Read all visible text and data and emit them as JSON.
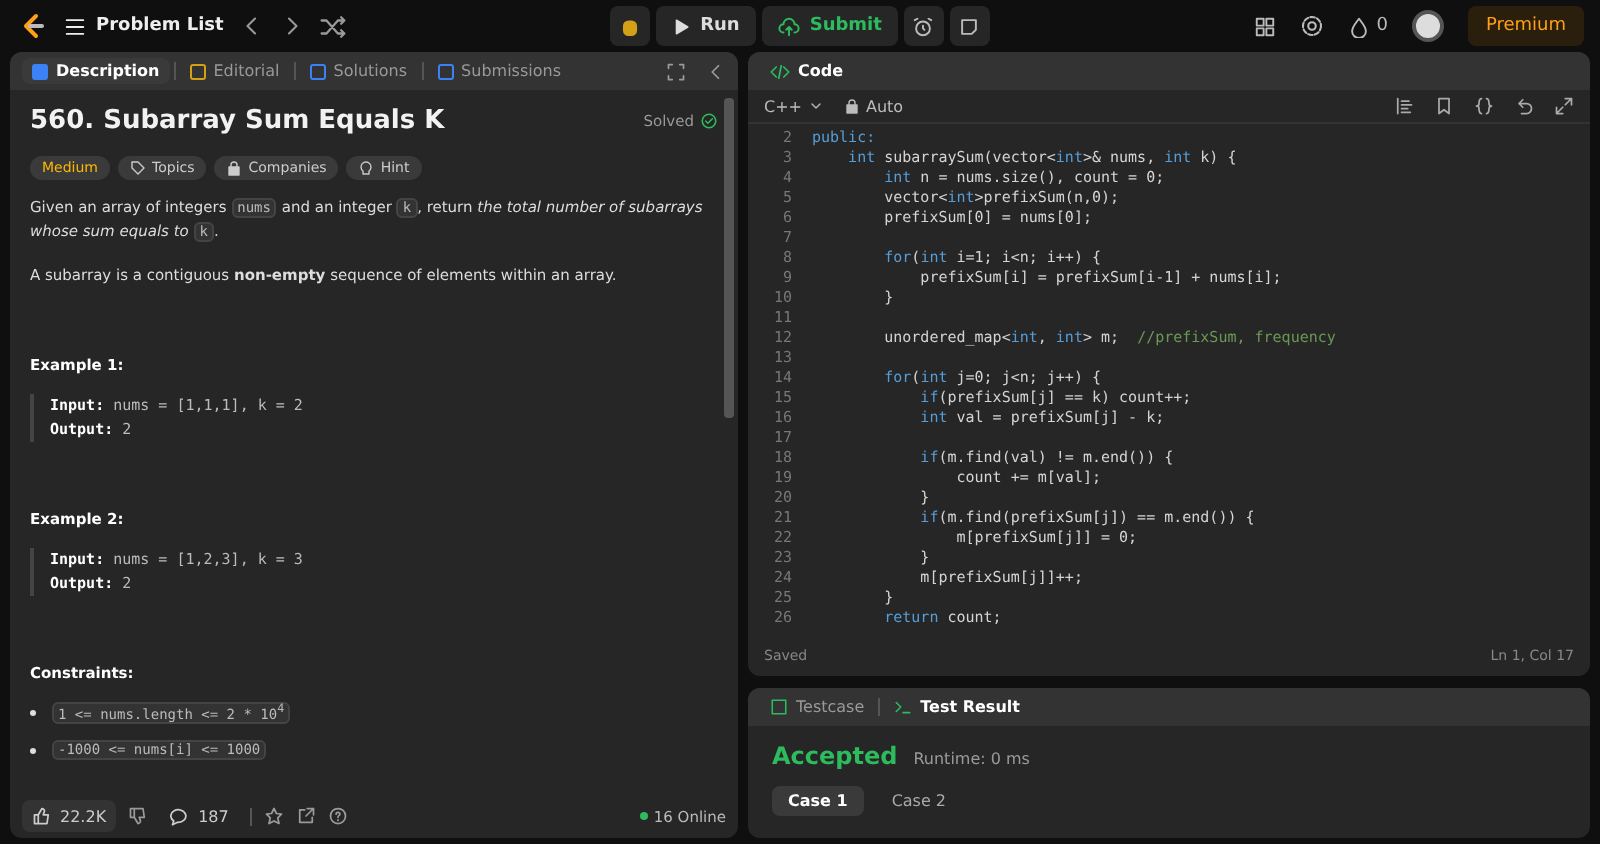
{
  "topbar": {
    "problem_list": "Problem List",
    "run": "Run",
    "submit": "Submit",
    "streak": "0",
    "premium": "Premium"
  },
  "description_tabs": [
    {
      "label": "Description",
      "selected": true,
      "color": "#3b82f6"
    },
    {
      "label": "Editorial",
      "selected": false,
      "color": "#d4a017"
    },
    {
      "label": "Solutions",
      "selected": false,
      "color": "#3b82f6"
    },
    {
      "label": "Submissions",
      "selected": false,
      "color": "#3b82f6"
    }
  ],
  "problem": {
    "title": "560. Subarray Sum Equals K",
    "status": "Solved",
    "difficulty": "Medium",
    "tags": [
      {
        "label": "Topics",
        "kind": "tag"
      },
      {
        "label": "Companies",
        "kind": "lock"
      },
      {
        "label": "Hint",
        "kind": "bulb"
      }
    ],
    "statement": [
      {
        "kind": "text",
        "text": "Given an array of integers "
      },
      {
        "kind": "code",
        "text": "nums"
      },
      {
        "kind": "text",
        "text": " and an integer "
      },
      {
        "kind": "code",
        "text": "k"
      },
      {
        "kind": "text",
        "text": ", return "
      },
      {
        "kind": "italic",
        "text": "the total number of subarrays whose sum equals to "
      },
      {
        "kind": "code",
        "text": "k"
      },
      {
        "kind": "text",
        "text": "."
      }
    ],
    "note": "A subarray is a contiguous **non-empty** sequence of elements within an array.",
    "examples": [
      {
        "heading": "Example 1:",
        "input_label": "Input:",
        "input": "nums = [1,1,1], k = 2",
        "output_label": "Output:",
        "output": "2"
      },
      {
        "heading": "Example 2:",
        "input_label": "Input:",
        "input": "nums = [1,2,3], k = 3",
        "output_label": "Output:",
        "output": "2"
      }
    ],
    "constraints_heading": "Constraints:",
    "constraints": [
      "1 <= nums.length <= 2 * 10$^{4}$",
      "-1000 <= nums[i] <= 1000"
    ]
  },
  "footer": {
    "likes": "22.2K",
    "comments": "187",
    "online": "16 Online"
  },
  "code_panel": {
    "title": "Code",
    "language": "C++",
    "mode": "Auto",
    "status": "Saved",
    "cursor": "Ln 1, Col 17",
    "lines": [
      {
        "number": "2",
        "tokens": [
          {
            "kind": "kw",
            "text": "public:"
          }
        ]
      },
      {
        "number": "3",
        "tokens": [
          {
            "kind": "kw",
            "text": "    int"
          },
          {
            "kind": "plain",
            "text": " subarraySum(vector<"
          },
          {
            "kind": "kw",
            "text": "int"
          },
          {
            "kind": "plain",
            "text": ">& nums, "
          },
          {
            "kind": "kw",
            "text": "int"
          },
          {
            "kind": "plain",
            "text": " k) {"
          }
        ]
      },
      {
        "number": "4",
        "tokens": [
          {
            "kind": "kw",
            "text": "        int"
          },
          {
            "kind": "plain",
            "text": " n = nums.size(), count = 0;"
          }
        ]
      },
      {
        "number": "5",
        "tokens": [
          {
            "kind": "plain",
            "text": "        vector<"
          },
          {
            "kind": "kw",
            "text": "int"
          },
          {
            "kind": "plain",
            "text": ">prefixSum(n,0);"
          }
        ]
      },
      {
        "number": "6",
        "tokens": [
          {
            "kind": "plain",
            "text": "        prefixSum[0] = nums[0];"
          }
        ]
      },
      {
        "number": "7"
      },
      {
        "number": "8",
        "tokens": [
          {
            "kind": "kw",
            "text": "        for"
          },
          {
            "kind": "plain",
            "text": "("
          },
          {
            "kind": "kw",
            "text": "int"
          },
          {
            "kind": "plain",
            "text": " i=1; i<n; i++) {"
          }
        ]
      },
      {
        "number": "9",
        "tokens": [
          {
            "kind": "plain",
            "text": "            prefixSum[i] = prefixSum[i-1] + nums[i];"
          }
        ]
      },
      {
        "number": "10",
        "tokens": [
          {
            "kind": "plain",
            "text": "        }"
          }
        ]
      },
      {
        "number": "11"
      },
      {
        "number": "12",
        "tokens": [
          {
            "kind": "plain",
            "text": "        unordered_map<"
          },
          {
            "kind": "kw",
            "text": "int"
          },
          {
            "kind": "plain",
            "text": ", "
          },
          {
            "kind": "kw",
            "text": "int"
          },
          {
            "kind": "plain",
            "text": "> m;  "
          },
          {
            "kind": "comment",
            "text": "//prefixSum, frequency"
          }
        ]
      },
      {
        "number": "13"
      },
      {
        "number": "14",
        "tokens": [
          {
            "kind": "kw",
            "text": "        for"
          },
          {
            "kind": "plain",
            "text": "("
          },
          {
            "kind": "kw",
            "text": "int"
          },
          {
            "kind": "plain",
            "text": " j=0; j<n; j++) {"
          }
        ]
      },
      {
        "number": "15",
        "tokens": [
          {
            "kind": "kw",
            "text": "            if"
          },
          {
            "kind": "plain",
            "text": "(prefixSum[j] == k) count++;"
          }
        ]
      },
      {
        "number": "16",
        "tokens": [
          {
            "kind": "kw",
            "text": "            int"
          },
          {
            "kind": "plain",
            "text": " val = prefixSum[j] - k;"
          }
        ]
      },
      {
        "number": "17"
      },
      {
        "number": "18",
        "tokens": [
          {
            "kind": "kw",
            "text": "            if"
          },
          {
            "kind": "plain",
            "text": "(m.find(val) != m.end()) {"
          }
        ]
      },
      {
        "number": "19",
        "tokens": [
          {
            "kind": "plain",
            "text": "                count += m[val];"
          }
        ]
      },
      {
        "number": "20",
        "tokens": [
          {
            "kind": "plain",
            "text": "            }"
          }
        ]
      },
      {
        "number": "21",
        "tokens": [
          {
            "kind": "kw",
            "text": "            if"
          },
          {
            "kind": "plain",
            "text": "(m.find(prefixSum[j]) == m.end()) {"
          }
        ]
      },
      {
        "number": "22",
        "tokens": [
          {
            "kind": "plain",
            "text": "                m[prefixSum[j]] = 0;"
          }
        ]
      },
      {
        "number": "23",
        "tokens": [
          {
            "kind": "plain",
            "text": "            }"
          }
        ]
      },
      {
        "number": "24",
        "tokens": [
          {
            "kind": "plain",
            "text": "            m[prefixSum[j]]++;"
          }
        ]
      },
      {
        "number": "25",
        "tokens": [
          {
            "kind": "plain",
            "text": "        }"
          }
        ]
      },
      {
        "number": "26",
        "tokens": [
          {
            "kind": "kw",
            "text": "        return"
          },
          {
            "kind": "plain",
            "text": " count;"
          }
        ]
      }
    ]
  },
  "test_tabs": [
    {
      "label": "Testcase",
      "selected": false
    },
    {
      "label": "Test Result",
      "selected": true
    }
  ],
  "result": {
    "verdict": "Accepted",
    "runtime": "Runtime: 0 ms",
    "cases": [
      {
        "label": "Case 1",
        "selected": true
      },
      {
        "label": "Case 2",
        "selected": false
      }
    ]
  }
}
